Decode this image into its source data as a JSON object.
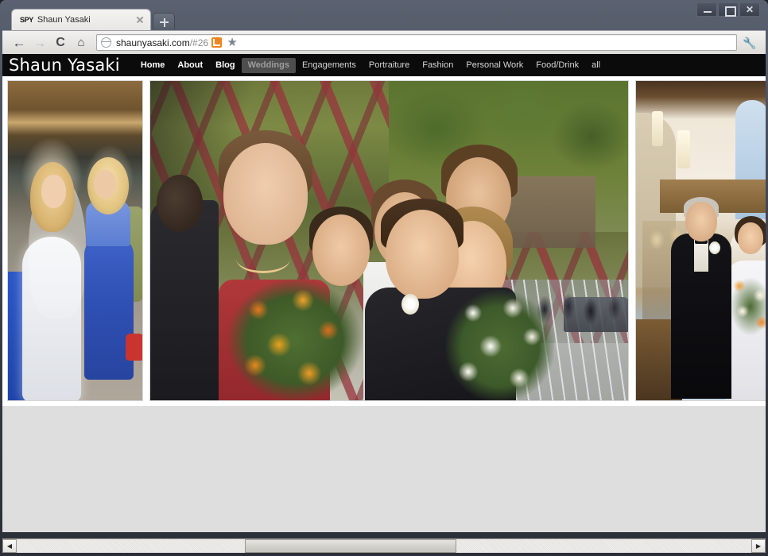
{
  "browser": {
    "tab": {
      "favicon_text": "SPY",
      "title": "Shaun Yasaki",
      "close_icon": "close-icon"
    },
    "new_tab_label": "+",
    "window_controls": {
      "minimize": "minimize-icon",
      "maximize": "maximize-icon",
      "close": "✕"
    },
    "toolbar": {
      "back": "←",
      "forward": "→",
      "reload": "C",
      "home": "⌂",
      "url_main": "shaunyasaki.com",
      "url_fragment": "/#26",
      "rss_icon": "rss-feed-icon",
      "bookmark_icon": "★",
      "menu_icon": "🔧"
    }
  },
  "site": {
    "logo": "Shaun Yasaki",
    "nav": [
      {
        "label": "Home",
        "state": "strong"
      },
      {
        "label": "About",
        "state": "strong"
      },
      {
        "label": "Blog",
        "state": "strong"
      },
      {
        "label": "Weddings",
        "state": "active"
      },
      {
        "label": "Engagements",
        "state": "normal"
      },
      {
        "label": "Portraiture",
        "state": "normal"
      },
      {
        "label": "Fashion",
        "state": "normal"
      },
      {
        "label": "Personal Work",
        "state": "normal"
      },
      {
        "label": "Food/Drink",
        "state": "normal"
      },
      {
        "label": "all",
        "state": "normal"
      }
    ],
    "gallery": {
      "photos": [
        {
          "id": "photo-bride-bridesmaid",
          "alt": "Bride in white gown with veil standing beside bridesmaid in blue dress on a porch"
        },
        {
          "id": "photo-wedding-party-bridge",
          "alt": "Wedding party laughing on a red steel bridge, bride and groom with bouquets"
        },
        {
          "id": "photo-church-aisle",
          "alt": "Father walking bride down the church aisle with orange and white bouquet"
        }
      ]
    },
    "background_color": "#dedede",
    "header_color": "#0b0b0b",
    "active_nav_color": "#4e4e4e"
  },
  "scrollbar": {
    "left_arrow": "◀",
    "right_arrow": "▶",
    "orientation": "horizontal"
  }
}
